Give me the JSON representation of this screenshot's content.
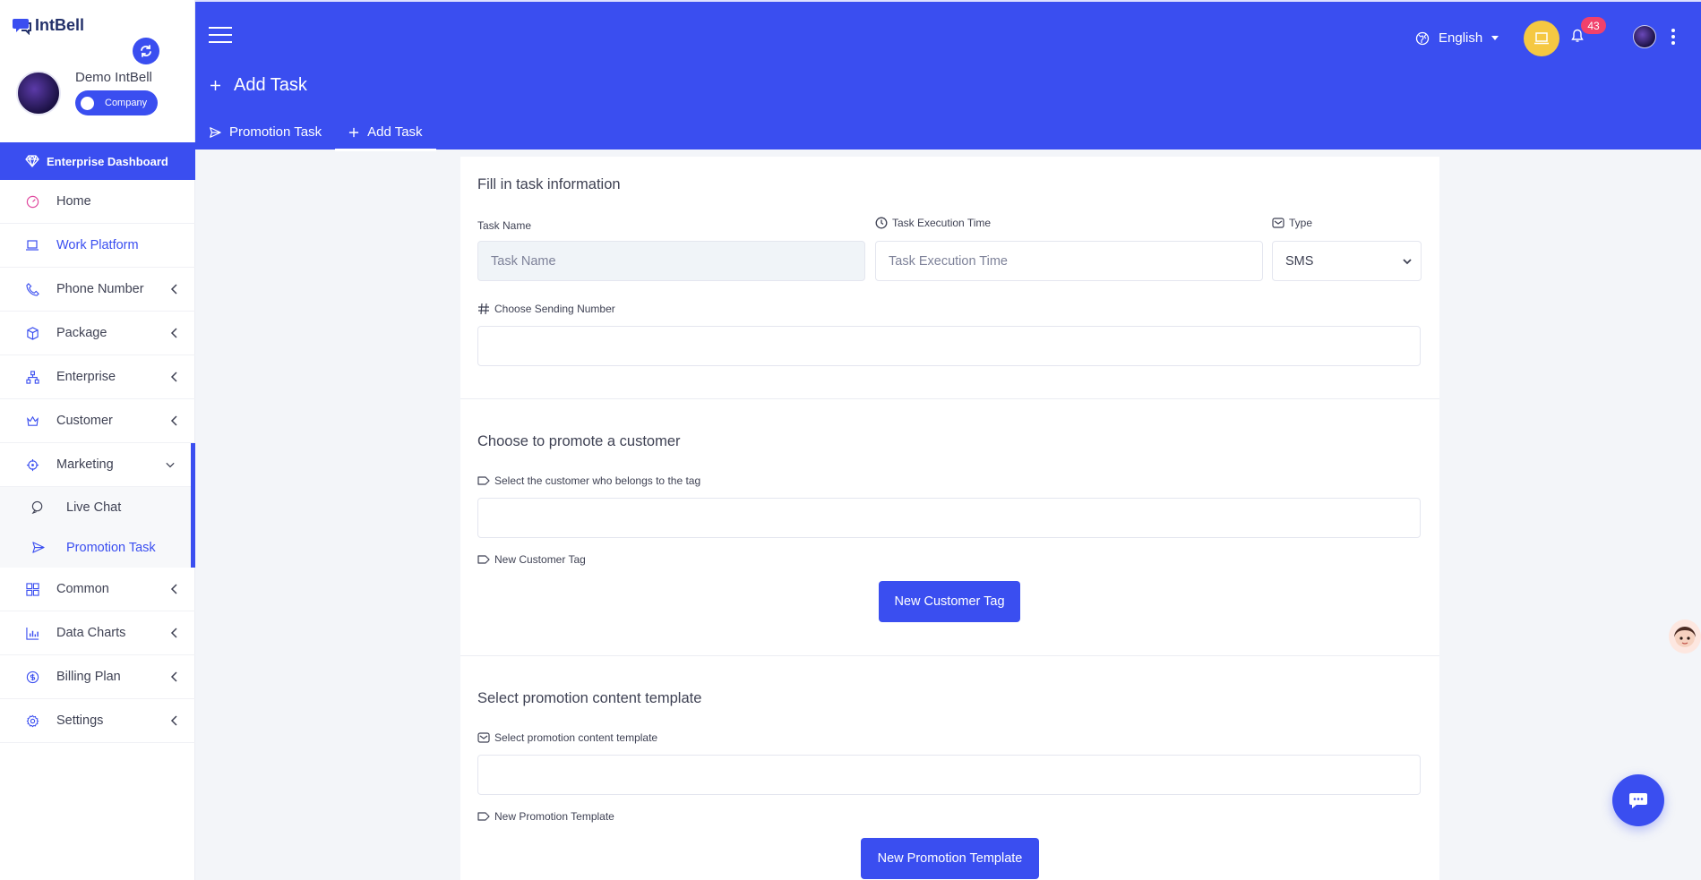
{
  "brand": {
    "name": "IntBell"
  },
  "profile": {
    "name": "Demo IntBell",
    "role_label": "Company"
  },
  "sidebar": {
    "dashboard_label": "Enterprise Dashboard",
    "items": [
      {
        "label": "Home",
        "icon": "gauge-icon"
      },
      {
        "label": "Work Platform",
        "icon": "laptop-icon"
      },
      {
        "label": "Phone Number",
        "icon": "phone-icon"
      },
      {
        "label": "Package",
        "icon": "box-icon"
      },
      {
        "label": "Enterprise",
        "icon": "sitemap-icon"
      },
      {
        "label": "Customer",
        "icon": "crown-icon"
      },
      {
        "label": "Marketing",
        "icon": "target-icon"
      }
    ],
    "marketing_sub": [
      {
        "label": "Live Chat",
        "icon": "chat-icon"
      },
      {
        "label": "Promotion Task",
        "icon": "send-icon"
      }
    ],
    "items_after": [
      {
        "label": "Common",
        "icon": "grid-icon"
      },
      {
        "label": "Data Charts",
        "icon": "bar-chart-icon"
      },
      {
        "label": "Billing Plan",
        "icon": "dollar-icon"
      },
      {
        "label": "Settings",
        "icon": "gear-icon"
      }
    ]
  },
  "topbar": {
    "page_title": "Add Task",
    "language": "English",
    "notification_count": "43",
    "tabs": [
      {
        "label": "Promotion Task"
      },
      {
        "label": "Add Task"
      }
    ]
  },
  "form": {
    "section1": {
      "title": "Fill in task information",
      "task_name_label": "Task Name",
      "task_name_placeholder": "Task Name",
      "exec_time_label": "Task Execution Time",
      "exec_time_placeholder": "Task Execution Time",
      "type_label": "Type",
      "type_value": "SMS",
      "sending_number_label": "Choose Sending Number"
    },
    "section2": {
      "title": "Choose to promote a customer",
      "tag_label": "Select the customer who belongs to the tag",
      "new_tag_label": "New Customer Tag",
      "new_tag_button": "New Customer Tag"
    },
    "section3": {
      "title": "Select promotion content template",
      "template_label": "Select promotion content template",
      "new_template_label": "New Promotion Template",
      "new_template_button": "New Promotion Template"
    }
  },
  "colors": {
    "primary": "#3a4ef0",
    "badge": "#f1416c",
    "accent_yellow": "#f5c842"
  }
}
